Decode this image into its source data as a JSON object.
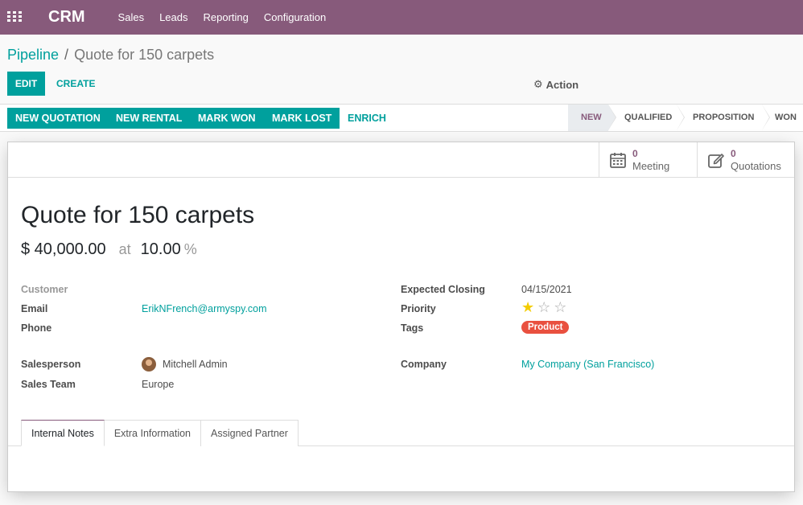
{
  "app": {
    "name": "CRM"
  },
  "menu": [
    "Sales",
    "Leads",
    "Reporting",
    "Configuration"
  ],
  "breadcrumb": {
    "parent": "Pipeline",
    "separator": "/",
    "current": "Quote for 150 carpets"
  },
  "controls": {
    "edit": "EDIT",
    "create": "CREATE",
    "action": "Action"
  },
  "statusbar": {
    "buttons": [
      "NEW QUOTATION",
      "NEW RENTAL",
      "MARK WON",
      "MARK LOST"
    ],
    "enrich": "ENRICH",
    "stages": [
      "NEW",
      "QUALIFIED",
      "PROPOSITION",
      "WON"
    ],
    "active_stage": "NEW"
  },
  "smart_buttons": {
    "meeting": {
      "count": "0",
      "label": "Meeting",
      "icon": "calendar-icon"
    },
    "quotations": {
      "count": "0",
      "label": "Quotations",
      "icon": "edit-icon"
    }
  },
  "lead": {
    "title": "Quote for 150 carpets",
    "revenue": "$ 40,000.00",
    "at": "at",
    "probability": "10.00",
    "pct": "%"
  },
  "fields": {
    "customer_label": "Customer",
    "email_label": "Email",
    "email": "ErikNFrench@armyspy.com",
    "phone_label": "Phone",
    "salesperson_label": "Salesperson",
    "salesperson": "Mitchell Admin",
    "team_label": "Sales Team",
    "team": "Europe",
    "closing_label": "Expected Closing",
    "closing": "04/15/2021",
    "priority_label": "Priority",
    "priority": 1,
    "priority_max": 3,
    "tags_label": "Tags",
    "tag": "Product",
    "company_label": "Company",
    "company": "My Company (San Francisco)"
  },
  "tabs": [
    "Internal Notes",
    "Extra Information",
    "Assigned Partner"
  ],
  "colors": {
    "brand": "#875a7b",
    "accent": "#00a09d",
    "tag": "#e9503f",
    "star": "#f3cc00"
  }
}
